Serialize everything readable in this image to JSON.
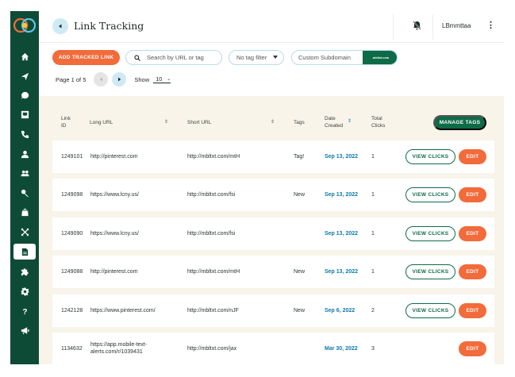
{
  "header": {
    "title": "Link Tracking",
    "user": "LBmmttaa"
  },
  "toolbar": {
    "add_label": "ADD TRACKED LINK",
    "search_placeholder": "Search by URL or tag",
    "tag_filter": "No tag filter",
    "subdomain_placeholder": "Custom Subdomain",
    "subdomain_suffix": ".mbltxt.com"
  },
  "pager": {
    "page_text": "Page 1 of 5",
    "show_label": "Show",
    "show_value": "10"
  },
  "table": {
    "columns": {
      "link_id": "Link ID",
      "long_url": "Long URL",
      "short_url": "Short URL",
      "tags": "Tags",
      "date_created": "Date Created",
      "total_clicks": "Total Clicks"
    },
    "manage_tags_label": "MANAGE TAGS",
    "view_clicks_label": "VIEW CLICKS",
    "edit_label": "EDIT",
    "rows": [
      {
        "id": "1249101",
        "long_url": "http://pinterest.com",
        "short_url": "http://mbltxt.com/mtH",
        "tags": "Tag!",
        "date": "Sep 13, 2022",
        "clicks": "1"
      },
      {
        "id": "1249098",
        "long_url": "https://www.lcny.us/",
        "short_url": "http://mbltxt.com/fsi",
        "tags": "New",
        "date": "Sep 13, 2022",
        "clicks": "1"
      },
      {
        "id": "1249090",
        "long_url": "https://www.lcny.us/",
        "short_url": "http://mbltxt.com/fsi",
        "tags": "",
        "date": "Sep 13, 2022",
        "clicks": "1"
      },
      {
        "id": "1249088",
        "long_url": "http://pinterest.com",
        "short_url": "http://mbltxt.com/mtH",
        "tags": "New",
        "date": "Sep 13, 2022",
        "clicks": "1"
      },
      {
        "id": "1242128",
        "long_url": "https://www.pinterest.com/",
        "short_url": "http://mbltxt.com/nJF",
        "tags": "New",
        "date": "Sep 6, 2022",
        "clicks": "2"
      },
      {
        "id": "1134632",
        "long_url": "https://app.mobile-text-alerts.com/r/1039431",
        "short_url": "http://mbltxt.com/jax",
        "tags": "",
        "date": "Mar 30, 2022",
        "clicks": "3"
      }
    ]
  },
  "colors": {
    "sidebar": "#0e4b36",
    "accent_orange": "#f26b3a",
    "accent_green": "#0e6b48",
    "date_blue": "#0e7ba8",
    "table_bg": "#f8f4ea"
  },
  "sidebar_icons": [
    "home-icon",
    "send-icon",
    "chat-icon",
    "inbox-icon",
    "phone-icon",
    "user-icon",
    "group-icon",
    "key-icon",
    "bag-icon",
    "shuffle-icon",
    "document-icon",
    "puzzle-icon",
    "gear-icon",
    "help-icon",
    "megaphone-icon"
  ]
}
